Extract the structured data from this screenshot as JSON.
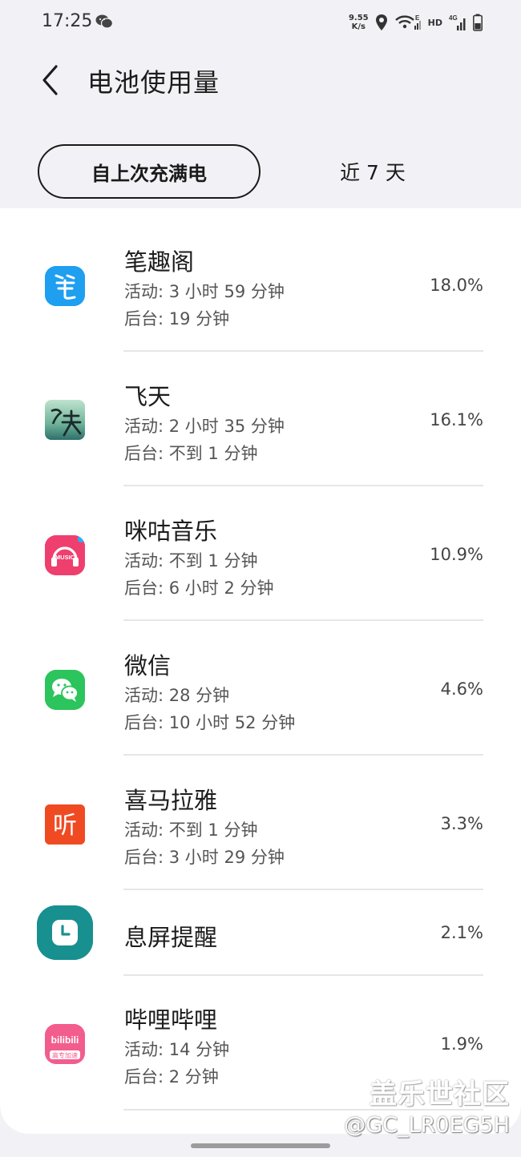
{
  "status_bar": {
    "time": "17:25",
    "net_speed_value": "9.55",
    "net_speed_unit": "K/s",
    "signal_label": "HD",
    "icons": [
      "wechat-icon",
      "location-icon",
      "wifi-icon",
      "signal-icon",
      "battery-icon"
    ]
  },
  "header": {
    "title": "电池使用量"
  },
  "tabs": [
    {
      "label": "自上次充满电",
      "selected": true
    },
    {
      "label": "近 7 天",
      "selected": false
    }
  ],
  "apps": [
    {
      "name": "笔趣阁",
      "active": "活动: 3 小时 59 分钟",
      "background": "后台: 19 分钟",
      "percent": "18.0%"
    },
    {
      "name": "飞天",
      "active": "活动: 2 小时 35 分钟",
      "background": "后台: 不到 1 分钟",
      "percent": "16.1%"
    },
    {
      "name": "咪咕音乐",
      "active": "活动: 不到 1 分钟",
      "background": "后台: 6 小时 2 分钟",
      "percent": "10.9%",
      "icon_text": "MUSIC"
    },
    {
      "name": "微信",
      "active": "活动: 28 分钟",
      "background": "后台: 10 小时 52 分钟",
      "percent": "4.6%"
    },
    {
      "name": "喜马拉雅",
      "active": "活动: 不到 1 分钟",
      "background": "后台: 3 小时 29 分钟",
      "percent": "3.3%",
      "icon_text": "听"
    },
    {
      "name": "息屏提醒",
      "percent": "2.1%"
    },
    {
      "name": "哔哩哔哩",
      "active": "活动: 14 分钟",
      "background": "后台: 2 分钟",
      "percent": "1.9%",
      "icon_text": "bilibili",
      "icon_subtext": "高专加速"
    }
  ],
  "watermark": {
    "line1": "盖乐世社区",
    "line2": "@GC_LR0EG5H"
  },
  "colors": {
    "background": "#f2f2f6",
    "card": "#ffffff",
    "biquge": "#1e9ff0",
    "migu": "#ef3f6e",
    "wechat": "#2cc45c",
    "ximalaya": "#f04a23",
    "clock": "#17908f",
    "bilibili": "#f25d8e"
  }
}
